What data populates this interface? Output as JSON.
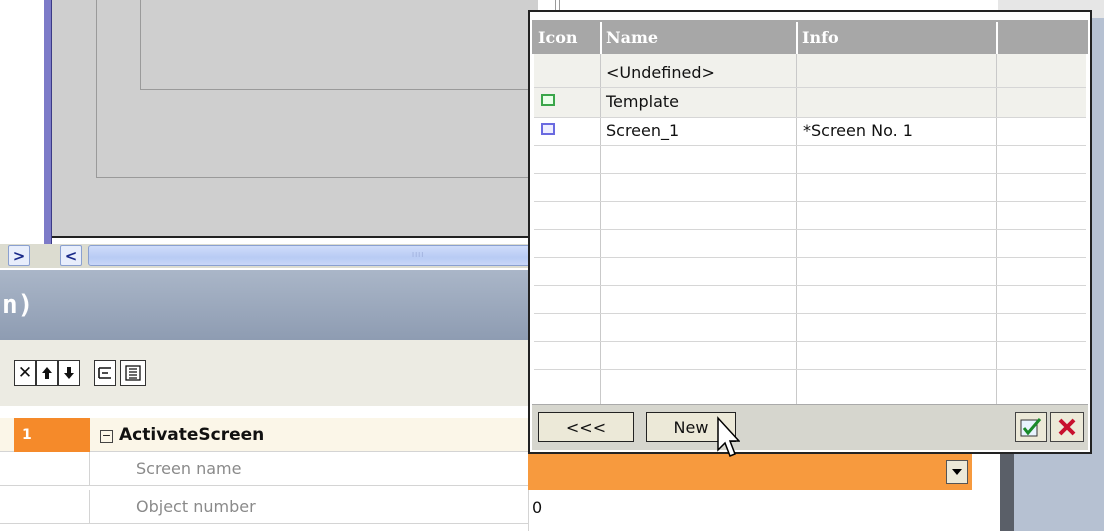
{
  "panel": {
    "title_fragment": "n)"
  },
  "scrollbar": {
    "left_arrow": ">",
    "right_arrow": "<",
    "grip": "IIII"
  },
  "toolbar": {
    "delete_glyph": "✕",
    "up_glyph": "🠕",
    "down_glyph": "🠗",
    "indent_glyph": "⊏",
    "list_glyph": "☰"
  },
  "function_list": {
    "row_index": "1",
    "function_name": "ActivateScreen",
    "collapse_glyph": "−",
    "parameters": [
      {
        "label": "Screen name",
        "value": ""
      },
      {
        "label": "Object number",
        "value": "0"
      }
    ]
  },
  "screen_picker": {
    "columns": [
      "Icon",
      "Name",
      "Info"
    ],
    "rows": [
      {
        "icon": "",
        "name": "<Undefined>",
        "info": ""
      },
      {
        "icon": "green-screen-icon",
        "name": "Template",
        "info": ""
      },
      {
        "icon": "blue-screen-icon",
        "name": "Screen_1",
        "info": "*Screen No. 1"
      }
    ],
    "back_label": "<<<",
    "new_label": "New",
    "ok_glyph": "✔",
    "cancel_glyph": "✖"
  },
  "colors": {
    "accent_orange": "#f58a2a",
    "header_grey": "#a7a7a7",
    "frame_purple": "#7d7bc8"
  }
}
